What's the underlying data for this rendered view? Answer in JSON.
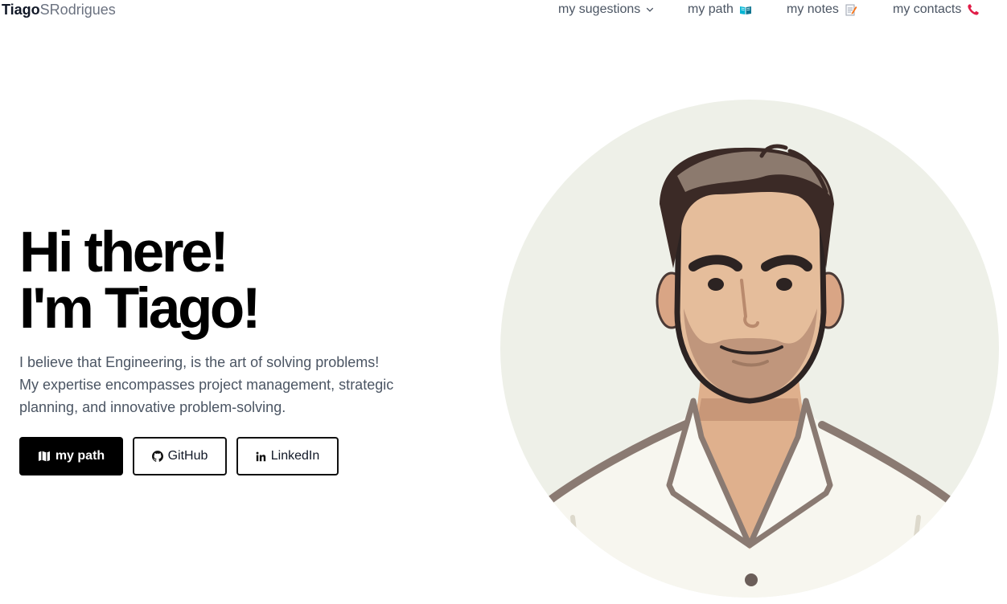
{
  "brand": {
    "bold": "Tiago",
    "light": "SRodrigues"
  },
  "nav": {
    "suggestions": "my sugestions",
    "path": "my path",
    "notes": "my notes",
    "contacts": "my contacts"
  },
  "hero": {
    "title_line1": "Hi there!",
    "title_line2": "I'm Tiago!",
    "text_line1": "I believe that Engineering, is the art of solving problems!",
    "text_line2": "My expertise encompasses project management, strategic",
    "text_line3": "planning, and innovative problem-solving."
  },
  "buttons": {
    "path": "my path",
    "github": "GitHub",
    "linkedin": "LinkedIn"
  },
  "icons": {
    "suggestions": "chevron-down-icon",
    "path": "open-book-icon",
    "notes": "memo-icon",
    "contacts": "telephone-receiver-icon",
    "path_button": "map-icon",
    "github": "github-icon",
    "linkedin": "linkedin-icon"
  },
  "colors": {
    "text_dark": "#111827",
    "text_muted": "#4b5563",
    "button_dark": "#000000",
    "avatar_background": "#eef0e8",
    "phone_icon": "#e11d48",
    "book_icon": "#0891b2"
  }
}
